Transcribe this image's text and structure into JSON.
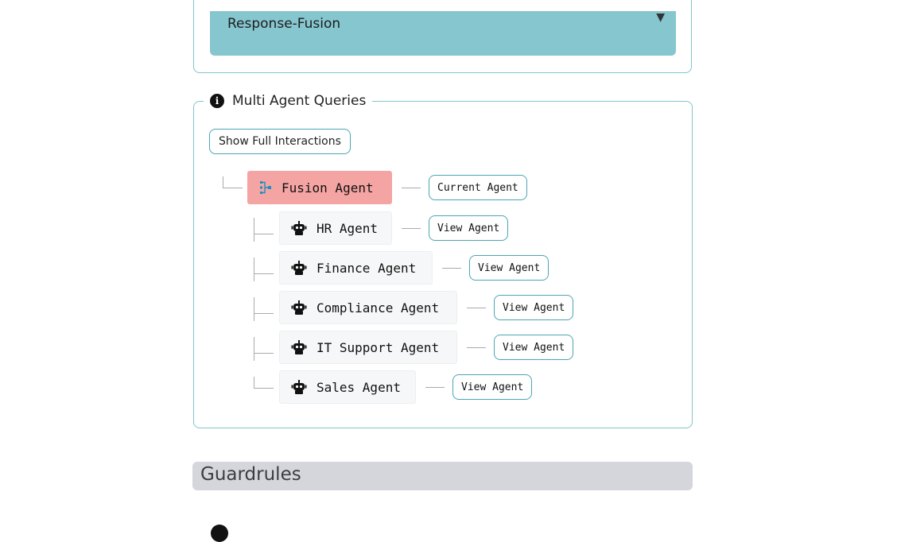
{
  "dropdown": {
    "value": "Response-Fusion",
    "arrow": "▼"
  },
  "multi_agent": {
    "legend": "Multi Agent Queries",
    "info_glyph": "i",
    "show_button": "Show Full Interactions",
    "root": {
      "name": "Fusion Agent",
      "action": "Current Agent"
    },
    "children": [
      {
        "name": "HR Agent",
        "action": "View Agent"
      },
      {
        "name": "Finance Agent",
        "action": "View Agent"
      },
      {
        "name": "Compliance Agent",
        "action": "View Agent"
      },
      {
        "name": "IT Support Agent",
        "action": "View Agent"
      },
      {
        "name": "Sales Agent",
        "action": "View Agent"
      }
    ]
  },
  "guardrules": {
    "title": "Guardrules"
  },
  "colors": {
    "accent": "#4aa5b3",
    "current_agent_bg": "#f4a4a2",
    "dropdown_bg": "#86c6cf",
    "section_bar": "#d4d6dc"
  },
  "icons": {
    "root": "fusion-flow-icon",
    "child": "robot-icon",
    "info": "info-icon"
  }
}
